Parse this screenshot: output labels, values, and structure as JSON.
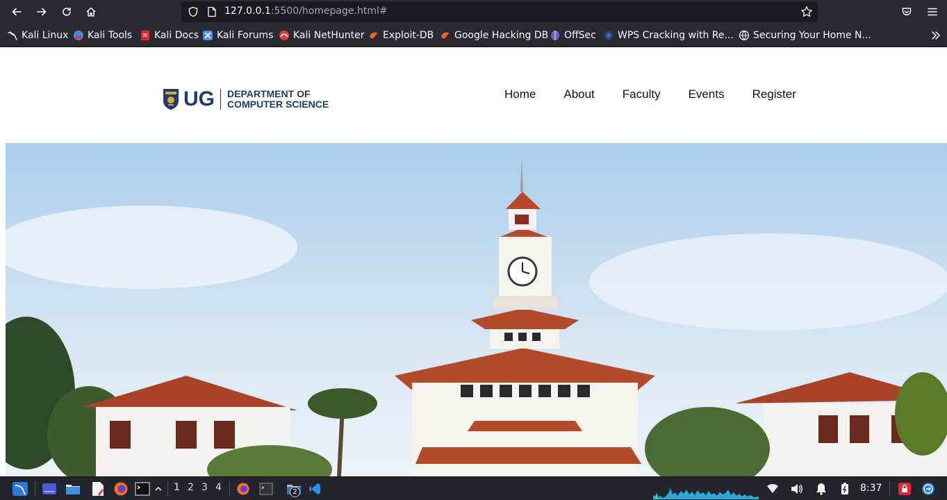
{
  "browser": {
    "url_host": "127.0.0.1",
    "url_rest": ":5500/homepage.html#"
  },
  "bookmarks": [
    {
      "label": "Kali Linux",
      "icon": "kali-dragon-icon",
      "color": "#e6e6e6"
    },
    {
      "label": "Kali Tools",
      "icon": "kali-tools-icon",
      "color": "#3b8beb"
    },
    {
      "label": "Kali Docs",
      "icon": "kali-docs-icon",
      "color": "#e02828"
    },
    {
      "label": "Kali Forums",
      "icon": "kali-forums-icon",
      "color": "#4a8ef0"
    },
    {
      "label": "Kali NetHunter",
      "icon": "nethunter-icon",
      "color": "#e23a3a"
    },
    {
      "label": "Exploit-DB",
      "icon": "exploit-db-icon",
      "color": "#f0642a"
    },
    {
      "label": "Google Hacking DB",
      "icon": "ghdb-icon",
      "color": "#f0642a"
    },
    {
      "label": "OffSec",
      "icon": "offsec-icon",
      "color": "#6c5ce7"
    },
    {
      "label": "WPS Cracking with Re...",
      "icon": "wps-icon",
      "color": "#2b4a7a"
    },
    {
      "label": "Securing Your Home N...",
      "icon": "globe-icon",
      "color": "#fbfbfe"
    }
  ],
  "site": {
    "logo_ug": "UG",
    "dept_line1": "DEPARTMENT OF",
    "dept_line2": "COMPUTER SCIENCE",
    "nav": [
      "Home",
      "About",
      "Faculty",
      "Events",
      "Register"
    ],
    "brand_color": "#1e3a6e"
  },
  "taskbar": {
    "workspaces": [
      "1",
      "2",
      "3",
      "4"
    ],
    "files_badge": "2",
    "clock": "8:37"
  }
}
